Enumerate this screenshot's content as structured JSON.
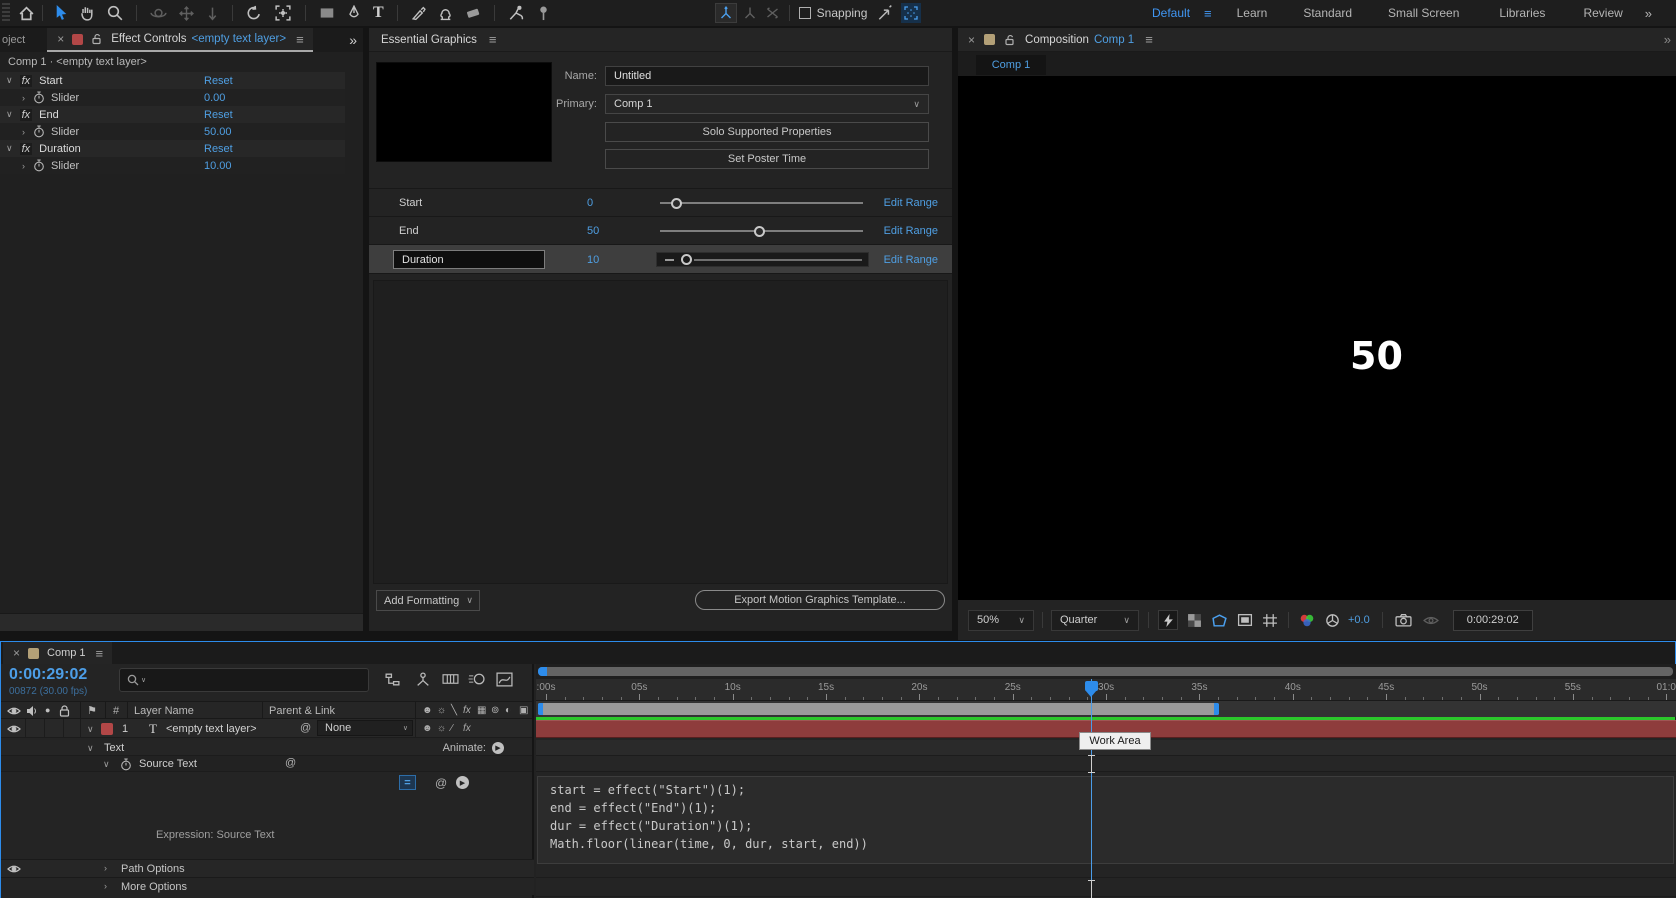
{
  "icons": {
    "hamburger": "≡",
    "close": "×",
    "overflow": "»",
    "chevron_down": "∨",
    "chevron_right": "›",
    "fx": "fx",
    "pickwhip": "@",
    "equals": "=",
    "play": "▶",
    "label_flag": "⚑",
    "solo_dot": "●",
    "shy": "☻",
    "collapse_sun": "☼",
    "quality_best": "╲",
    "quality_draft": "∕",
    "frame_blend": "▦",
    "motion_blur": "⊚",
    "adjustment": "◐",
    "three_d": "▣",
    "hash": "#",
    "dash": "—"
  },
  "toolbar": {
    "tools": [
      "home",
      "selection",
      "hand",
      "zoom",
      "orbit-camera",
      "pan-camera",
      "dolly-camera",
      "rotation",
      "pan-behind",
      "rectangle",
      "pen",
      "type",
      "brush",
      "clone-stamp",
      "eraser",
      "roto-brush",
      "puppet-pin"
    ],
    "axis_modes": [
      "local-axis",
      "world-axis",
      "view-axis"
    ],
    "snapping_label": "Snapping",
    "type_badge": "T"
  },
  "workspace": {
    "items": [
      "Default",
      "Learn",
      "Standard",
      "Small Screen",
      "Libraries",
      "Review"
    ],
    "active": "Default"
  },
  "effect_controls": {
    "hidden_tab_text": "oject",
    "title": "Effect Controls",
    "layer_ref": "<empty text layer>",
    "breadcrumb": "Comp 1 · <empty text layer>",
    "effects": [
      {
        "name": "Start",
        "action": "Reset",
        "property": "Slider",
        "value": "0.00"
      },
      {
        "name": "End",
        "action": "Reset",
        "property": "Slider",
        "value": "50.00"
      },
      {
        "name": "Duration",
        "action": "Reset",
        "property": "Slider",
        "value": "10.00"
      }
    ]
  },
  "essential_graphics": {
    "title": "Essential Graphics",
    "name_label": "Name:",
    "name_value": "Untitled",
    "primary_label": "Primary:",
    "primary_value": "Comp 1",
    "solo_button": "Solo Supported Properties",
    "poster_button": "Set Poster Time",
    "properties": [
      {
        "label": "Start",
        "value": "0",
        "link": "Edit Range"
      },
      {
        "label": "End",
        "value": "50",
        "link": "Edit Range"
      },
      {
        "label": "Duration",
        "value": "10",
        "link": "Edit Range"
      }
    ],
    "add_formatting": "Add Formatting",
    "export_button": "Export Motion Graphics Template..."
  },
  "composition": {
    "title": "Composition",
    "comp_name": "Comp 1",
    "viewer_tab": "Comp 1",
    "canvas_text": "50",
    "magnification": "50%",
    "resolution": "Quarter",
    "exposure": "+0.0",
    "timecode": "0:00:29:02"
  },
  "timeline": {
    "tab": "Comp 1",
    "timecode": "0:00:29:02",
    "frame_info": "00872 (30.00 fps)",
    "columns": {
      "index": "#",
      "layer_name": "Layer Name",
      "parent_link": "Parent & Link"
    },
    "layer": {
      "index": "1",
      "type_badge": "T",
      "name": "<empty text layer>",
      "parent": "None"
    },
    "groups": {
      "text": "Text",
      "animate": "Animate:",
      "source_text": "Source Text",
      "expression_caption": "Expression: Source Text",
      "path_options": "Path Options",
      "more_options": "More Options"
    },
    "expression_code": [
      "start = effect(\"Start\")(1);",
      "end = effect(\"End\")(1);",
      "dur = effect(\"Duration\")(1);",
      "Math.floor(linear(time, 0, dur, start, end))"
    ],
    "ruler_labels": [
      ":00s",
      "05s",
      "10s",
      "15s",
      "20s",
      "25s",
      "30s",
      "35s",
      "40s",
      "45s",
      "50s",
      "55s",
      "01:0"
    ],
    "work_area_tooltip": "Work Area"
  },
  "colors": {
    "accent_blue": "#2d8ceb",
    "link_blue": "#4f9fe3",
    "label_red": "#b24747",
    "layer_bar_red": "#8e3c3c",
    "cache_green": "#2bc72b",
    "comp_label_beige": "#b3a077"
  }
}
